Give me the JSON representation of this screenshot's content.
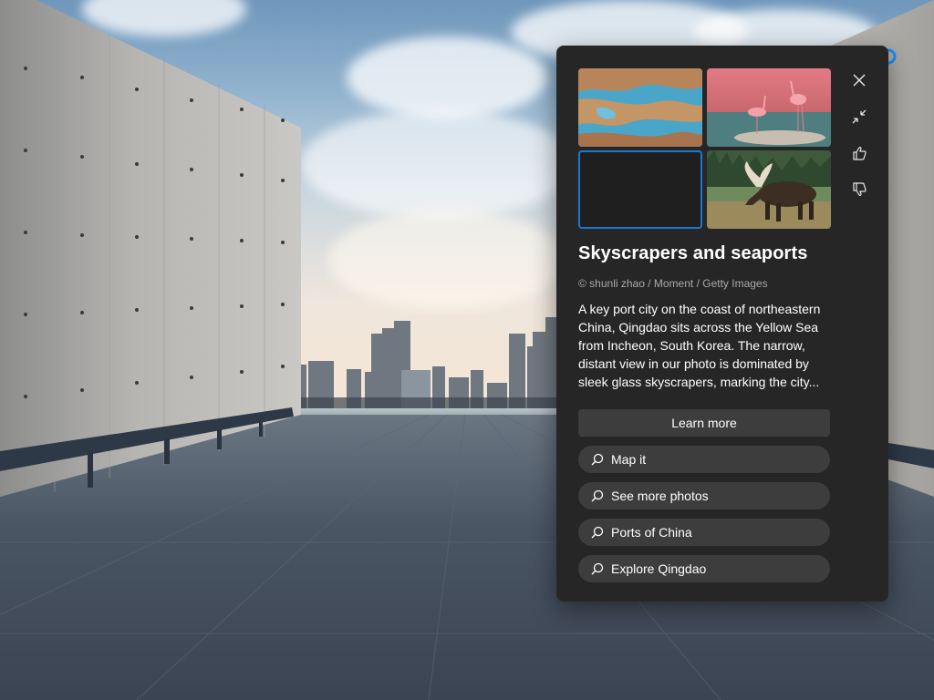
{
  "spotlight": {
    "title": "Skyscrapers and seaports",
    "credit": "© shunli zhao / Moment / Getty Images",
    "description": "A key port city on the coast of northeastern China, Qingdao sits across the Yellow Sea from Incheon, South Korea. The narrow, distant view in our photo is dominated by sleek glass skyscrapers, marking the city...",
    "learn_more_label": "Learn more",
    "searches": [
      {
        "label": "Map it",
        "icon": "search-icon"
      },
      {
        "label": "See more photos",
        "icon": "search-icon"
      },
      {
        "label": "Ports of China",
        "icon": "search-icon"
      },
      {
        "label": "Explore Qingdao",
        "icon": "search-icon"
      }
    ],
    "actions": [
      "close-icon",
      "collapse-icon",
      "thumbs-up-icon",
      "thumbs-down-icon"
    ],
    "thumbnails": [
      "desert-oasis-thumbnail",
      "flamingos-thumbnail",
      "selected-empty-thumbnail",
      "moose-thumbnail"
    ]
  },
  "colors": {
    "panel_bg": "#262626",
    "button_bg": "#3d3d3d",
    "selection_accent": "#1979d2",
    "cortana_accent": "#1a8fff"
  }
}
